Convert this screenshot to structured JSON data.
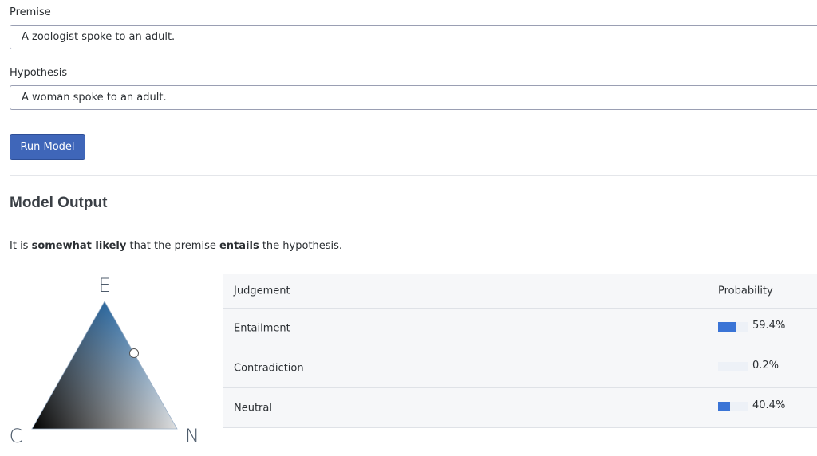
{
  "form": {
    "premise_label": "Premise",
    "premise_value": "A zoologist spoke to an adult.",
    "hypothesis_label": "Hypothesis",
    "hypothesis_value": "A woman spoke to an adult.",
    "run_button": "Run Model"
  },
  "output": {
    "title": "Model Output",
    "summary": {
      "prefix": "It is ",
      "strength": "somewhat likely",
      "middle": " that the premise ",
      "relation": "entails",
      "suffix": " the hypothesis."
    },
    "triangle": {
      "label_top": "E",
      "label_left": "C",
      "label_right": "N"
    },
    "table": {
      "headers": {
        "judgement": "Judgement",
        "probability": "Probability"
      },
      "rows": [
        {
          "judgement": "Entailment",
          "probability": 59.4,
          "label": "59.4%"
        },
        {
          "judgement": "Contradiction",
          "probability": 0.2,
          "label": "0.2%"
        },
        {
          "judgement": "Neutral",
          "probability": 40.4,
          "label": "40.4%"
        }
      ]
    },
    "colors": {
      "bar": "#3a74d6",
      "bar_track": "#edf1f7",
      "button": "#3f66b9"
    }
  }
}
